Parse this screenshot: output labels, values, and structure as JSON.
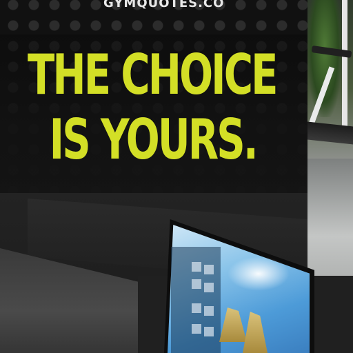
{
  "poster": {
    "watermark": "GYMQUOTES.CO",
    "headline_line1": "THE CHOICE",
    "headline_line2": "IS YOURS.",
    "accent_color": "#d3df26"
  },
  "scene": {
    "monitor_wallpaper": "sky-and-rocks-wallpaper",
    "background": "gym-treadmill"
  }
}
